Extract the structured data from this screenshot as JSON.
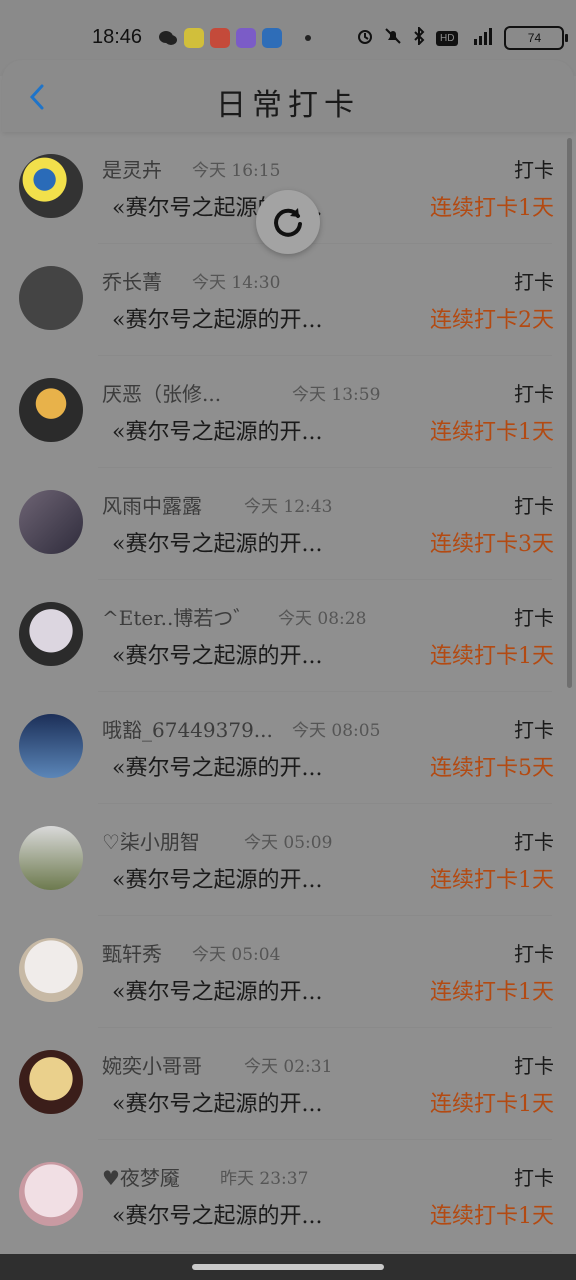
{
  "status_bar": {
    "time": "18:46",
    "apps": [
      "WeChat",
      "快看",
      "红包",
      "哔哩",
      "支付宝"
    ],
    "signal": "4G",
    "hd": "HD",
    "battery": "74"
  },
  "header": {
    "title": "日常打卡"
  },
  "colors": {
    "accent": "#b34a12",
    "text": "#1a1a1a",
    "muted": "#555555"
  },
  "items": [
    {
      "name": "是灵卉",
      "time": "今天 16:15",
      "label": "打卡",
      "content": "«赛尔号之起源的开...",
      "streak": "连续打卡1天"
    },
    {
      "name": "乔长菁",
      "time": "今天 14:30",
      "label": "打卡",
      "content": "«赛尔号之起源的开...",
      "streak": "连续打卡2天"
    },
    {
      "name": "厌恶（张修...",
      "time": "今天 13:59",
      "label": "打卡",
      "content": "«赛尔号之起源的开...",
      "streak": "连续打卡1天"
    },
    {
      "name": "风雨中露露",
      "time": "今天 12:43",
      "label": "打卡",
      "content": "«赛尔号之起源的开...",
      "streak": "连续打卡3天"
    },
    {
      "name": "^Eter..博若つ゛",
      "time": "今天 08:28",
      "label": "打卡",
      "content": "«赛尔号之起源的开...",
      "streak": "连续打卡1天"
    },
    {
      "name": "哦豁_67449379...",
      "time": "今天 08:05",
      "label": "打卡",
      "content": "«赛尔号之起源的开...",
      "streak": "连续打卡5天"
    },
    {
      "name": "♡柒小朋智",
      "time": "今天 05:09",
      "label": "打卡",
      "content": "«赛尔号之起源的开...",
      "streak": "连续打卡1天"
    },
    {
      "name": "甄轩秀",
      "time": "今天 05:04",
      "label": "打卡",
      "content": "«赛尔号之起源的开...",
      "streak": "连续打卡1天"
    },
    {
      "name": "婉奕小哥哥",
      "time": "今天 02:31",
      "label": "打卡",
      "content": "«赛尔号之起源的开...",
      "streak": "连续打卡1天"
    },
    {
      "name": "♥夜梦魇",
      "time": "昨天 23:37",
      "label": "打卡",
      "content": "«赛尔号之起源的开...",
      "streak": "连续打卡1天"
    }
  ]
}
